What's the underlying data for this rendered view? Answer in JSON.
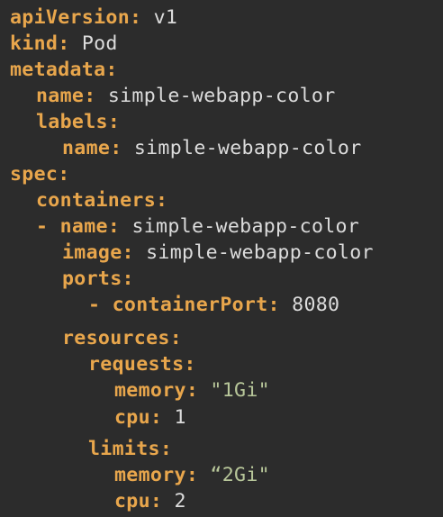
{
  "colors": {
    "background": "#2c2c2c",
    "key": "#e8a64c",
    "value": "#dcdcdc",
    "string": "#b8c79a"
  },
  "yaml": {
    "api_version": {
      "key": "apiVersion",
      "value": "v1"
    },
    "kind": {
      "key": "kind",
      "value": "Pod"
    },
    "metadata": {
      "key": "metadata"
    },
    "metadata_name": {
      "key": "name",
      "value": "simple-webapp-color"
    },
    "labels": {
      "key": "labels"
    },
    "labels_name": {
      "key": "name",
      "value": "simple-webapp-color"
    },
    "spec": {
      "key": "spec"
    },
    "containers": {
      "key": "containers"
    },
    "container_dash": "-",
    "container_name": {
      "key": "name",
      "value": "simple-webapp-color"
    },
    "image": {
      "key": "image",
      "value": "simple-webapp-color"
    },
    "ports": {
      "key": "ports"
    },
    "port_dash": "-",
    "container_port": {
      "key": "containerPort",
      "value": "8080"
    },
    "resources": {
      "key": "resources"
    },
    "requests": {
      "key": "requests"
    },
    "requests_memory": {
      "key": "memory",
      "value": "\"1Gi\""
    },
    "requests_cpu": {
      "key": "cpu",
      "value": "1"
    },
    "limits": {
      "key": "limits"
    },
    "limits_memory": {
      "key": "memory",
      "value": "“2Gi\""
    },
    "limits_cpu": {
      "key": "cpu",
      "value": "2"
    }
  }
}
